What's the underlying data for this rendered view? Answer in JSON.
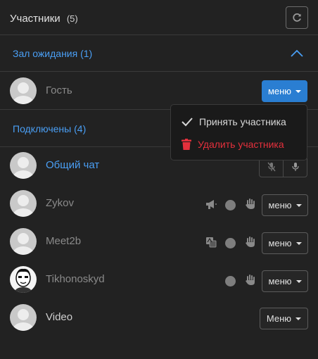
{
  "header": {
    "title": "Участники",
    "count": "(5)"
  },
  "waiting": {
    "title": "Зал ожидания (1)",
    "participants": [
      {
        "name": "Гость",
        "menu_label": "меню"
      }
    ]
  },
  "dropdown": {
    "accept": "Принять участника",
    "remove": "Удалить участника"
  },
  "connected": {
    "title": "Подключены (4)",
    "rows": [
      {
        "name": "Общий чат"
      },
      {
        "name": "Zykov",
        "menu_label": "меню"
      },
      {
        "name": "Meet2b",
        "menu_label": "меню"
      },
      {
        "name": "Tikhonoskyd",
        "menu_label": "меню"
      },
      {
        "name": "Video",
        "menu_label": "Меню"
      }
    ]
  },
  "colors": {
    "accent": "#4a9ff5",
    "primary_button": "#2a7ed2",
    "danger": "#e5303c",
    "background": "#222222"
  }
}
